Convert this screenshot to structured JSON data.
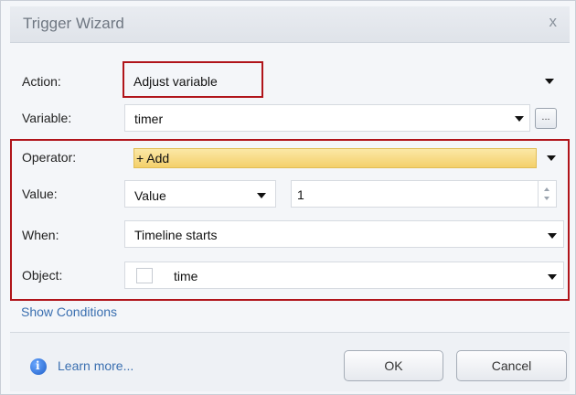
{
  "dialog": {
    "title": "Trigger Wizard",
    "close_glyph": "x"
  },
  "fields": {
    "action": {
      "label": "Action:",
      "value": "Adjust variable"
    },
    "variable": {
      "label": "Variable:",
      "value": "timer",
      "browse_label": "..."
    },
    "operator": {
      "label": "Operator:",
      "value": "+ Add"
    },
    "value": {
      "label": "Value:",
      "type": "Value",
      "number": "1"
    },
    "when": {
      "label": "When:",
      "value": "Timeline starts"
    },
    "object": {
      "label": "Object:",
      "value": "time"
    }
  },
  "links": {
    "show_conditions": "Show Conditions",
    "learn_more": "Learn more..."
  },
  "buttons": {
    "ok": "OK",
    "cancel": "Cancel"
  },
  "colors": {
    "highlight_red": "#b0141a",
    "operator_fill": "#f7d774",
    "link_blue": "#3a6fb0"
  },
  "icons": {
    "info": "info-icon",
    "dropdown": "chevron-down-icon"
  }
}
